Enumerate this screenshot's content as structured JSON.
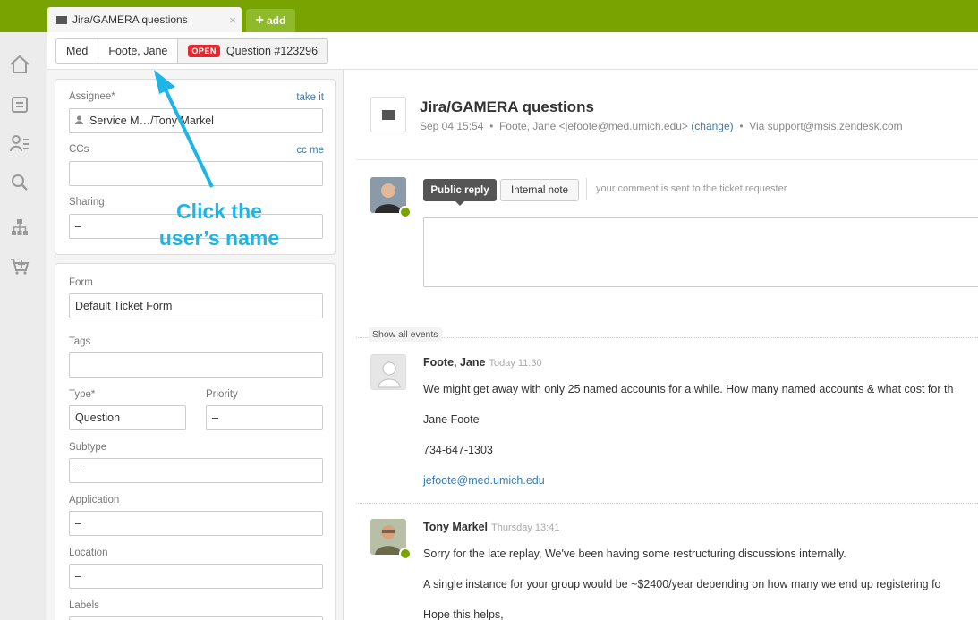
{
  "tabs": {
    "active_title": "Jira/GAMERA questions",
    "close_glyph": "×",
    "add_label": "add"
  },
  "breadcrumb": {
    "org": "Med",
    "requester": "Foote, Jane",
    "status_badge": "OPEN",
    "ticket": "Question #123296"
  },
  "properties": {
    "assignee_label": "Assignee*",
    "take_it": "take it",
    "assignee_value": "Service M…/Tony Markel",
    "ccs_label": "CCs",
    "cc_me": "cc me",
    "sharing_label": "Sharing",
    "sharing_value": "–",
    "form_label": "Form",
    "form_value": "Default Ticket Form",
    "tags_label": "Tags",
    "type_label": "Type*",
    "type_value": "Question",
    "priority_label": "Priority",
    "priority_value": "–",
    "subtype_label": "Subtype",
    "subtype_value": "–",
    "application_label": "Application",
    "application_value": "–",
    "location_label": "Location",
    "location_value": "–",
    "labels_label": "Labels"
  },
  "ticket": {
    "subject": "Jira/GAMERA questions",
    "date": "Sep 04 15:54",
    "requester": "Foote, Jane <jefoote@med.umich.edu>",
    "change": "(change)",
    "via": "Via support@msis.zendesk.com",
    "bullet": "•"
  },
  "reply": {
    "public_reply": "Public reply",
    "internal_note": "Internal note",
    "hint": "your comment is sent to the ticket requester"
  },
  "events": {
    "show_all": "Show all events",
    "comments": [
      {
        "author": "Foote, Jane",
        "time": "Today 11:30",
        "lines": [
          "We might get away with only 25 named accounts for a while. How many named accounts & what cost for th",
          "Jane Foote",
          "734-647-1303",
          "jefoote@med.umich.edu"
        ]
      },
      {
        "author": "Tony Markel",
        "time": "Thursday 13:41",
        "lines": [
          "Sorry for the late replay, We've been having some restructuring discussions internally.",
          "A single instance for your group would be ~$2400/year depending on how many we end up registering fo",
          "Hope this helps,"
        ]
      }
    ]
  },
  "annotation": {
    "line1": "Click the",
    "line2": "user’s name"
  },
  "colors": {
    "brand_green": "#78a300",
    "open_red": "#e3282f",
    "annotation_cyan": "#1cb5e5",
    "link_blue": "#3a7bb0"
  },
  "icons": [
    "home-icon",
    "tickets-icon",
    "users-icon",
    "search-icon",
    "org-chart-icon",
    "cart-icon",
    "mail-icon",
    "user-icon"
  ]
}
